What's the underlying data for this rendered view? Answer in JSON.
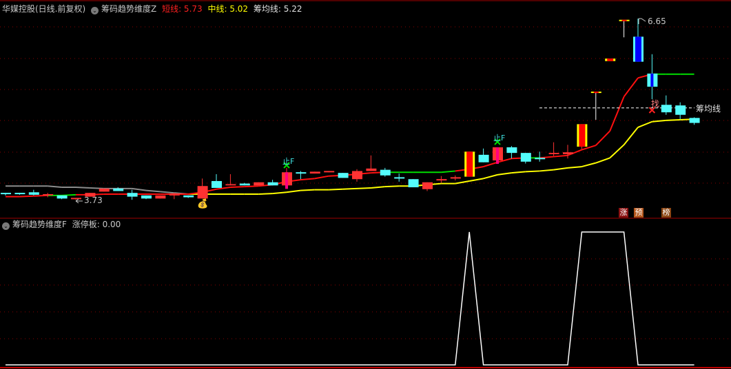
{
  "header": {
    "stock": "华媒控股(日线.前复权)",
    "indicator": "筹码趋势维度Z",
    "short_label": "短线: 5.73",
    "mid_label": "中线: 5.02",
    "avg_label": "筹均线: 5.22"
  },
  "sub_header": {
    "indicator": "筹码趋势维度F",
    "value_label": "涨停板: 0.00"
  },
  "colors": {
    "up": "#ff3232",
    "down": "#54fcfc",
    "short": "#ff1010",
    "mid": "#ffff00",
    "falling_seg": "#00e000",
    "early_mid": "#8c8c8c",
    "grid": "#8b0000"
  },
  "annotations": {
    "low_label": "3.73",
    "high_label": "6.65",
    "avg_line_label": "筹均线",
    "signal_text": "止F",
    "buy_text": "找",
    "tags": [
      {
        "text": "涨",
        "color": "#8b1010"
      },
      {
        "text": "预",
        "color": "#b5561c"
      },
      {
        "text": "榜",
        "color": "#8b4513"
      }
    ],
    "money-bag-icon": "money-bag"
  },
  "chart_data": [
    {
      "type": "candlestick",
      "price_range": [
        3.73,
        6.65
      ],
      "avg_line": 5.22,
      "candles": [
        [
          3.85,
          3.84,
          3.86,
          3.82,
          ""
        ],
        [
          3.85,
          3.84,
          3.86,
          3.83,
          ""
        ],
        [
          3.87,
          3.83,
          3.91,
          3.82,
          ""
        ],
        [
          3.82,
          3.84,
          3.86,
          3.79,
          ""
        ],
        [
          3.82,
          3.77,
          3.82,
          3.76,
          ""
        ],
        [
          3.76,
          3.77,
          3.78,
          3.75,
          ""
        ],
        [
          3.8,
          3.86,
          3.86,
          3.8,
          ""
        ],
        [
          3.88,
          3.93,
          3.93,
          3.88,
          ""
        ],
        [
          3.93,
          3.89,
          3.95,
          3.89,
          ""
        ],
        [
          3.86,
          3.8,
          3.91,
          3.75,
          ""
        ],
        [
          3.82,
          3.77,
          3.82,
          3.76,
          ""
        ],
        [
          3.77,
          3.82,
          3.82,
          3.77,
          ""
        ],
        [
          3.83,
          3.83,
          3.86,
          3.76,
          ""
        ],
        [
          3.82,
          3.79,
          3.82,
          3.78,
          ""
        ],
        [
          3.77,
          3.97,
          4.09,
          3.77,
          ""
        ],
        [
          4.05,
          3.94,
          4.16,
          3.94,
          ""
        ],
        [
          3.98,
          4.0,
          4.16,
          3.98,
          ""
        ],
        [
          4.01,
          3.98,
          4.02,
          3.98,
          ""
        ],
        [
          3.98,
          4.03,
          4.03,
          3.98,
          ""
        ],
        [
          4.03,
          3.98,
          4.07,
          3.98,
          ""
        ],
        [
          3.98,
          4.19,
          4.26,
          3.96,
          "magenta"
        ],
        [
          4.18,
          4.18,
          4.21,
          4.08,
          "downdoji"
        ],
        [
          4.17,
          4.2,
          4.2,
          4.17,
          ""
        ],
        [
          4.2,
          4.2,
          4.21,
          4.19,
          ""
        ],
        [
          4.18,
          4.1,
          4.18,
          4.1,
          ""
        ],
        [
          4.08,
          4.21,
          4.24,
          4.04,
          ""
        ],
        [
          4.21,
          4.25,
          4.46,
          4.21,
          ""
        ],
        [
          4.23,
          4.14,
          4.26,
          4.12,
          ""
        ],
        [
          4.1,
          4.1,
          4.17,
          4.04,
          "downdoji"
        ],
        [
          4.08,
          3.95,
          4.08,
          3.95,
          ""
        ],
        [
          3.92,
          4.03,
          4.03,
          3.89,
          ""
        ],
        [
          4.07,
          4.07,
          4.13,
          4.02,
          ""
        ],
        [
          4.1,
          4.1,
          4.14,
          4.06,
          ""
        ],
        [
          4.12,
          4.52,
          4.52,
          4.12,
          "limit"
        ],
        [
          4.47,
          4.35,
          4.57,
          4.35,
          ""
        ],
        [
          4.38,
          4.59,
          4.59,
          4.33,
          "magenta"
        ],
        [
          4.59,
          4.5,
          4.61,
          4.41,
          ""
        ],
        [
          4.5,
          4.36,
          4.5,
          4.33,
          ""
        ],
        [
          4.41,
          4.41,
          4.52,
          4.36,
          "downdoji"
        ],
        [
          4.48,
          4.5,
          4.67,
          4.45,
          ""
        ],
        [
          4.48,
          4.51,
          4.63,
          4.41,
          ""
        ],
        [
          4.6,
          4.96,
          4.96,
          4.56,
          "limit"
        ],
        [
          5.47,
          5.47,
          5.47,
          5.03,
          "limitdoji"
        ],
        [
          5.97,
          6.01,
          6.01,
          5.97,
          "limit"
        ],
        [
          6.62,
          6.62,
          6.62,
          6.35,
          "limitdoji"
        ],
        [
          6.36,
          5.96,
          6.65,
          5.96,
          "blue"
        ],
        [
          5.77,
          5.56,
          6.08,
          5.36,
          "bluecenter"
        ],
        [
          5.27,
          5.15,
          5.42,
          5.11,
          ""
        ],
        [
          5.26,
          5.11,
          5.31,
          5.04,
          ""
        ],
        [
          5.06,
          4.98,
          5.07,
          4.95,
          ""
        ]
      ],
      "short_line": [
        3.8,
        3.8,
        3.81,
        3.82,
        3.82,
        3.83,
        3.83,
        3.84,
        3.84,
        3.84,
        3.84,
        3.84,
        3.84,
        3.84,
        3.87,
        3.92,
        3.95,
        3.96,
        3.97,
        3.99,
        4.04,
        4.07,
        4.09,
        4.13,
        4.14,
        4.16,
        4.18,
        4.19,
        4.19,
        4.19,
        4.19,
        4.19,
        4.21,
        4.24,
        4.28,
        4.35,
        4.41,
        4.42,
        4.42,
        4.44,
        4.46,
        4.55,
        4.62,
        4.85,
        5.4,
        5.7,
        5.76,
        5.76,
        5.76,
        5.76
      ],
      "short_line_green_ranges": [
        [
          3,
          5
        ],
        [
          27,
          32
        ],
        [
          37,
          38
        ],
        [
          46,
          49
        ]
      ],
      "mid_line": [
        3.97,
        3.97,
        3.97,
        3.97,
        3.95,
        3.95,
        3.94,
        3.93,
        3.93,
        3.93,
        3.9,
        3.88,
        3.86,
        3.84,
        3.84,
        3.84,
        3.84,
        3.84,
        3.84,
        3.85,
        3.87,
        3.9,
        3.91,
        3.91,
        3.92,
        3.93,
        3.94,
        3.96,
        3.97,
        3.97,
        3.99,
        4.01,
        4.01,
        4.05,
        4.09,
        4.15,
        4.18,
        4.2,
        4.21,
        4.23,
        4.26,
        4.28,
        4.34,
        4.42,
        4.63,
        4.91,
        5.0,
        5.02,
        5.03,
        5.04
      ],
      "mid_line_gray_until": 13
    },
    {
      "type": "line",
      "name": "涨停板",
      "values": [
        0,
        0,
        0,
        0,
        0,
        0,
        0,
        0,
        0,
        0,
        0,
        0,
        0,
        0,
        0,
        0,
        0,
        0,
        0,
        0,
        0,
        0,
        0,
        0,
        0,
        0,
        0,
        0,
        0,
        0,
        0,
        0,
        0,
        1,
        0,
        0,
        0,
        0,
        0,
        0,
        0,
        1,
        1,
        1,
        1,
        0,
        0,
        0,
        0,
        0
      ]
    }
  ]
}
